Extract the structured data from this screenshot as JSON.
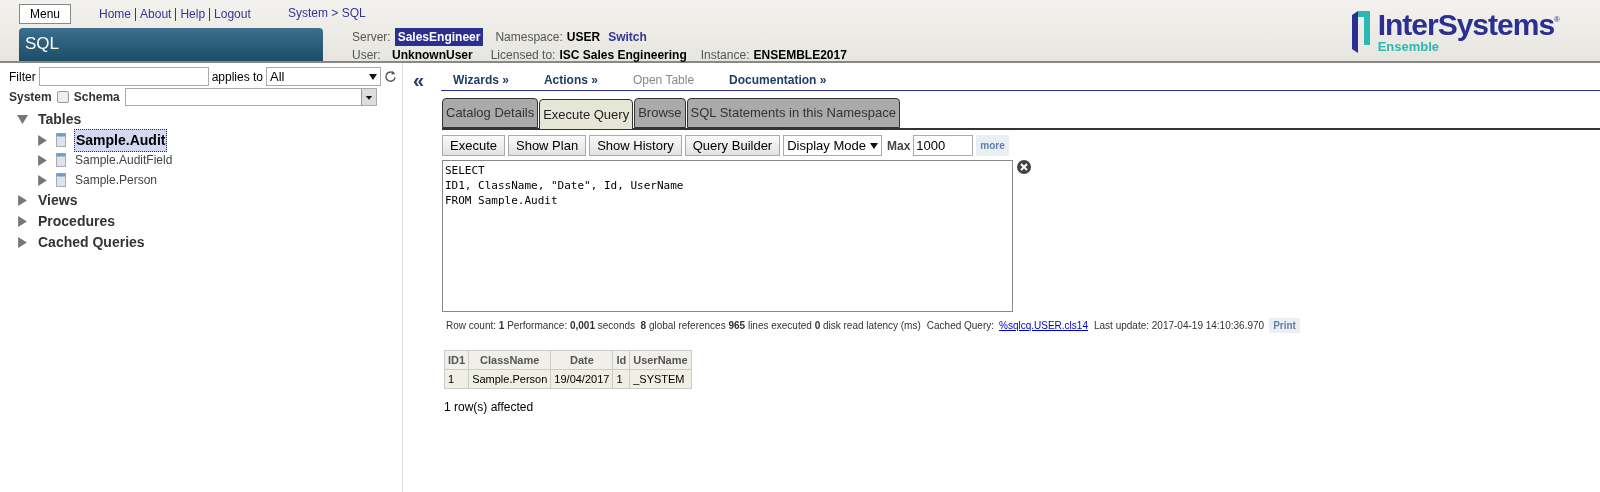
{
  "header": {
    "menu_button": "Menu",
    "links": [
      "Home",
      "About",
      "Help",
      "Logout"
    ],
    "breadcrumb": "System > SQL",
    "title": "SQL",
    "server_label": "Server:",
    "server": "SalesEngineer",
    "namespace_label": "Namespace:",
    "namespace": "USER",
    "switch_link": "Switch",
    "user_label": "User:",
    "user": "UnknownUser",
    "licensed_label": "Licensed to:",
    "licensed": "ISC Sales Engineering",
    "instance_label": "Instance:",
    "instance": "ENSEMBLE2017",
    "logo": {
      "name": "InterSystems",
      "sub": "Ensemble",
      "mark": "®"
    }
  },
  "sidebar": {
    "filter_label": "Filter",
    "applies_label": "applies to",
    "applies_value": "All",
    "system_label": "System",
    "system_checked": false,
    "schema_label": "Schema",
    "tree": [
      {
        "label": "Tables",
        "expanded": true,
        "children": [
          {
            "label": "Sample.Audit",
            "selected": true
          },
          {
            "label": "Sample.AuditField",
            "selected": false
          },
          {
            "label": "Sample.Person",
            "selected": false
          }
        ]
      },
      {
        "label": "Views",
        "expanded": false
      },
      {
        "label": "Procedures",
        "expanded": false
      },
      {
        "label": "Cached Queries",
        "expanded": false
      }
    ]
  },
  "collapse_icon": "«",
  "menubar": [
    {
      "label": "Wizards »",
      "disabled": false
    },
    {
      "label": "Actions »",
      "disabled": false
    },
    {
      "label": "Open Table",
      "disabled": true
    },
    {
      "label": "Documentation »",
      "disabled": false
    }
  ],
  "tabs": [
    {
      "label": "Catalog Details",
      "selected": false
    },
    {
      "label": "Execute Query",
      "selected": true
    },
    {
      "label": "Browse",
      "selected": false
    },
    {
      "label": "SQL Statements in this Namespace",
      "selected": false
    }
  ],
  "toolbar": {
    "buttons": [
      "Execute",
      "Show Plan",
      "Show History",
      "Query Builder"
    ],
    "display_mode": "Display Mode",
    "max_label": "Max",
    "max_value": "1000",
    "more_link": "more"
  },
  "query": "SELECT\nID1, ClassName, \"Date\", Id, UserName\nFROM Sample.Audit",
  "stats": {
    "text": "Row count: **1** Performance: **0,001** seconds  **8** global references **965** lines executed **0** disk read latency (ms)",
    "cached_label": "Cached Query:",
    "cached_link": "%sqlcq.USER.cls14",
    "last_update": "Last update: 2017-04-19 14:10:36.970",
    "print_button": "Print"
  },
  "results": {
    "columns": [
      "ID1",
      "ClassName",
      "Date",
      "Id",
      "UserName"
    ],
    "rows": [
      [
        "1",
        "Sample.Person",
        "19/04/2017",
        "1",
        "_SYSTEM"
      ]
    ]
  },
  "affected": "1 row(s) affected"
}
